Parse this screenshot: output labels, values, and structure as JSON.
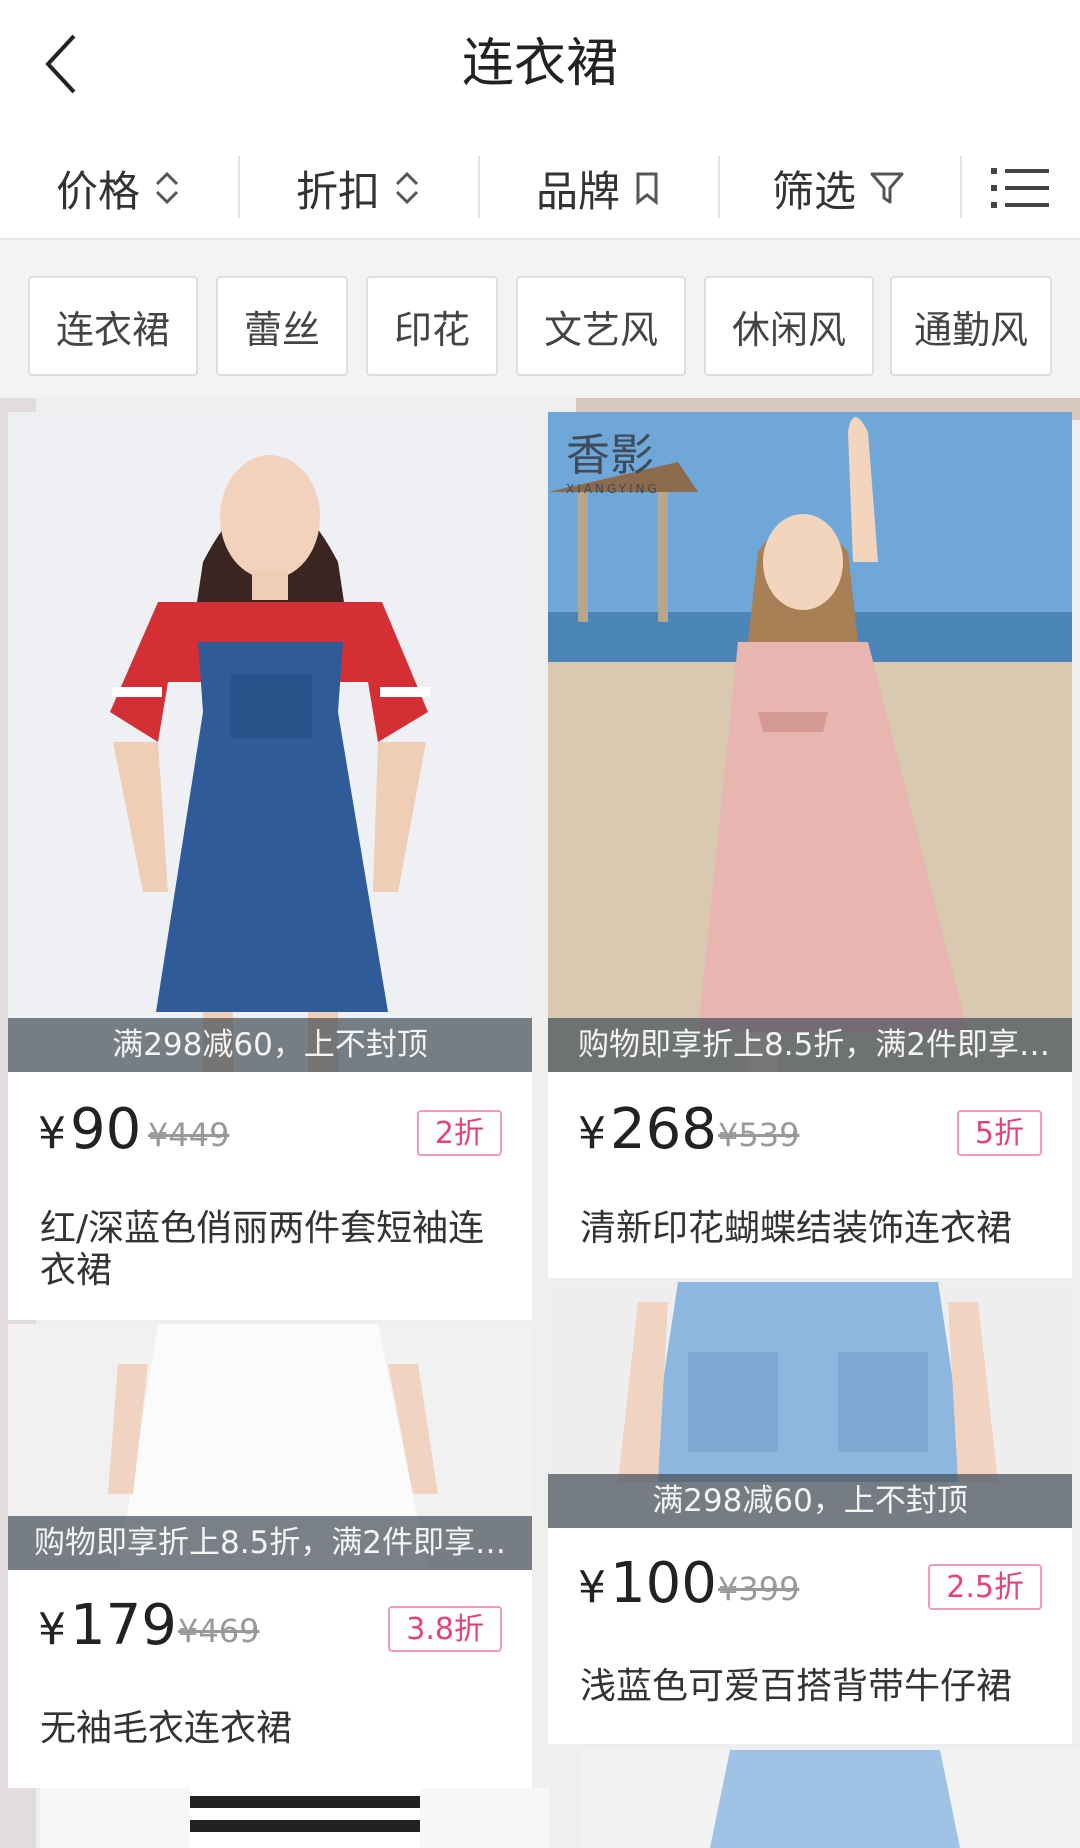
{
  "header": {
    "title": "连衣裙"
  },
  "sortbar": {
    "price_label": "价格",
    "discount_label": "折扣",
    "brand_label": "品牌",
    "filter_label": "筛选"
  },
  "tags": [
    "连衣裙",
    "蕾丝",
    "印花",
    "文艺风",
    "休闲风",
    "通勤风"
  ],
  "products": [
    {
      "promo": "满298减60，上不封顶",
      "price": "90",
      "original_price": "¥449",
      "discount": "2折",
      "name": "红/深蓝色俏丽两件套短袖连衣裙"
    },
    {
      "promo": "购物即享折上8.5折，满2件即享…",
      "price": "268",
      "original_price": "¥539",
      "discount": "5折",
      "name": "清新印花蝴蝶结装饰连衣裙",
      "brand_logo": "香影",
      "brand_logo_sub": "XIANGYING"
    },
    {
      "promo": "购物即享折上8.5折，满2件即享…",
      "price": "179",
      "original_price": "¥469",
      "discount": "3.8折",
      "name": "无袖毛衣连衣裙"
    },
    {
      "promo": "满298减60，上不封顶",
      "price": "100",
      "original_price": "¥399",
      "discount": "2.5折",
      "name": "浅蓝色可爱百搭背带牛仔裙"
    }
  ],
  "currency_symbol": "¥"
}
